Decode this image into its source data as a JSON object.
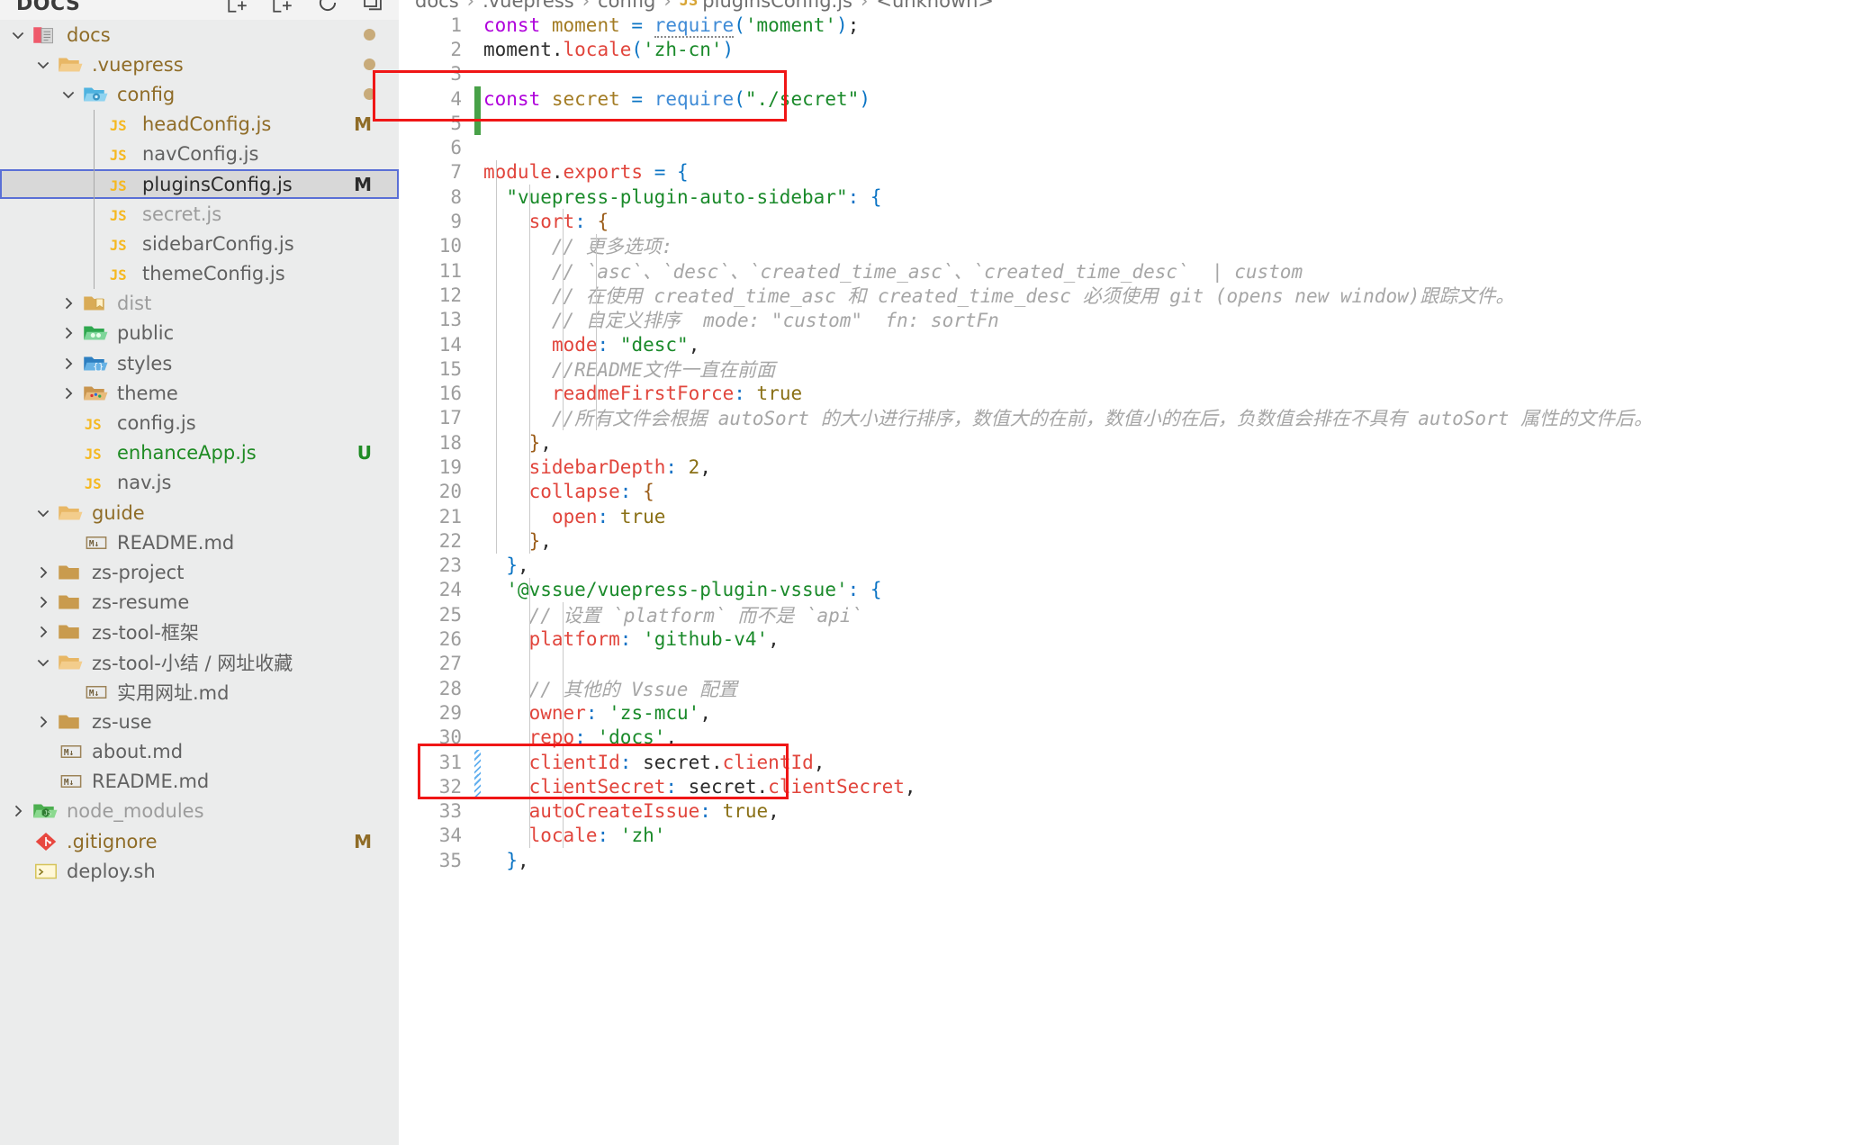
{
  "explorer": {
    "title": "DOCS",
    "actions": [
      "new-file-icon",
      "new-folder-icon",
      "refresh-icon",
      "collapse-all-icon"
    ]
  },
  "tree": [
    {
      "indent": 0,
      "twisty": "down",
      "icon": "folder-docs",
      "label": "docs",
      "labelColor": "mod",
      "badge": "",
      "dot": true
    },
    {
      "indent": 1,
      "twisty": "down",
      "icon": "folder-open",
      "label": ".vuepress",
      "labelColor": "mod",
      "badge": "",
      "dot": true
    },
    {
      "indent": 2,
      "twisty": "down",
      "icon": "folder-config",
      "label": "config",
      "labelColor": "mod",
      "badge": "",
      "dot": true
    },
    {
      "indent": 3,
      "twisty": "none",
      "icon": "js",
      "label": "headConfig.js",
      "labelColor": "mod",
      "badge": "M",
      "badgeColor": "mod",
      "dot": false
    },
    {
      "indent": 3,
      "twisty": "none",
      "icon": "js",
      "label": "navConfig.js",
      "labelColor": "norm",
      "badge": "",
      "dot": false
    },
    {
      "indent": 3,
      "twisty": "none",
      "icon": "js",
      "label": "pluginsConfig.js",
      "labelColor": "sel",
      "badge": "M",
      "badgeColor": "sel",
      "dot": false,
      "selected": true
    },
    {
      "indent": 3,
      "twisty": "none",
      "icon": "js",
      "label": "secret.js",
      "labelColor": "dim",
      "badge": "",
      "dot": false
    },
    {
      "indent": 3,
      "twisty": "none",
      "icon": "js",
      "label": "sidebarConfig.js",
      "labelColor": "norm",
      "badge": "",
      "dot": false
    },
    {
      "indent": 3,
      "twisty": "none",
      "icon": "js",
      "label": "themeConfig.js",
      "labelColor": "norm",
      "badge": "",
      "dot": false
    },
    {
      "indent": 2,
      "twisty": "right",
      "icon": "folder-dist",
      "label": "dist",
      "labelColor": "dim",
      "badge": "",
      "dot": false
    },
    {
      "indent": 2,
      "twisty": "right",
      "icon": "folder-public",
      "label": "public",
      "labelColor": "norm",
      "badge": "",
      "dot": false
    },
    {
      "indent": 2,
      "twisty": "right",
      "icon": "folder-styles",
      "label": "styles",
      "labelColor": "norm",
      "badge": "",
      "dot": false
    },
    {
      "indent": 2,
      "twisty": "right",
      "icon": "folder-theme",
      "label": "theme",
      "labelColor": "norm",
      "badge": "",
      "dot": false
    },
    {
      "indent": 2,
      "twisty": "none",
      "icon": "js",
      "label": "config.js",
      "labelColor": "norm",
      "badge": "",
      "dot": false
    },
    {
      "indent": 2,
      "twisty": "none",
      "icon": "js",
      "label": "enhanceApp.js",
      "labelColor": "add",
      "badge": "U",
      "badgeColor": "add",
      "dot": false
    },
    {
      "indent": 2,
      "twisty": "none",
      "icon": "js",
      "label": "nav.js",
      "labelColor": "norm",
      "badge": "",
      "dot": false
    },
    {
      "indent": 1,
      "twisty": "down",
      "icon": "folder-open",
      "label": "guide",
      "labelColor": "mod",
      "badge": "",
      "dot": false
    },
    {
      "indent": 2,
      "twisty": "none",
      "icon": "md",
      "label": "README.md",
      "labelColor": "norm",
      "badge": "",
      "dot": false
    },
    {
      "indent": 1,
      "twisty": "right",
      "icon": "folder-closed",
      "label": "zs-project",
      "labelColor": "norm",
      "badge": "",
      "dot": false
    },
    {
      "indent": 1,
      "twisty": "right",
      "icon": "folder-closed",
      "label": "zs-resume",
      "labelColor": "norm",
      "badge": "",
      "dot": false
    },
    {
      "indent": 1,
      "twisty": "right",
      "icon": "folder-closed",
      "label": "zs-tool-框架",
      "labelColor": "norm",
      "badge": "",
      "dot": false
    },
    {
      "indent": 1,
      "twisty": "down",
      "icon": "folder-open",
      "label": "zs-tool-小结 / 网址收藏",
      "labelColor": "norm",
      "badge": "",
      "dot": false
    },
    {
      "indent": 2,
      "twisty": "none",
      "icon": "md",
      "label": "实用网址.md",
      "labelColor": "norm",
      "badge": "",
      "dot": false
    },
    {
      "indent": 1,
      "twisty": "right",
      "icon": "folder-closed",
      "label": "zs-use",
      "labelColor": "norm",
      "badge": "",
      "dot": false
    },
    {
      "indent": 1,
      "twisty": "none",
      "icon": "md",
      "label": "about.md",
      "labelColor": "norm",
      "badge": "",
      "dot": false
    },
    {
      "indent": 1,
      "twisty": "none",
      "icon": "md",
      "label": "README.md",
      "labelColor": "norm",
      "badge": "",
      "dot": false
    },
    {
      "indent": 0,
      "twisty": "right",
      "icon": "folder-node",
      "label": "node_modules",
      "labelColor": "dim",
      "badge": "",
      "dot": false
    },
    {
      "indent": 0,
      "twisty": "none",
      "icon": "git",
      "label": ".gitignore",
      "labelColor": "mod",
      "badge": "M",
      "badgeColor": "mod",
      "dot": false
    },
    {
      "indent": 0,
      "twisty": "none",
      "icon": "sh",
      "label": "deploy.sh",
      "labelColor": "norm",
      "badge": "",
      "dot": false
    }
  ],
  "breadcrumb": {
    "parts": [
      "docs",
      ".vuepress",
      "config"
    ],
    "file": "pluginsConfig.js",
    "symbol": "<unknown>"
  },
  "code": {
    "language": "javascript",
    "first_line": 1,
    "lines": [
      {
        "n": 1,
        "gutter": "none",
        "text": "const moment = require('moment');"
      },
      {
        "n": 2,
        "gutter": "none",
        "text": "moment.locale('zh-cn')"
      },
      {
        "n": 3,
        "gutter": "none",
        "text": ""
      },
      {
        "n": 4,
        "gutter": "add",
        "text": "const secret = require(\"./secret\")"
      },
      {
        "n": 5,
        "gutter": "add",
        "text": ""
      },
      {
        "n": 6,
        "gutter": "none",
        "text": ""
      },
      {
        "n": 7,
        "gutter": "none",
        "text": "module.exports = {"
      },
      {
        "n": 8,
        "gutter": "none",
        "text": "  \"vuepress-plugin-auto-sidebar\": {"
      },
      {
        "n": 9,
        "gutter": "none",
        "text": "    sort: {"
      },
      {
        "n": 10,
        "gutter": "none",
        "text": "      // 更多选项:"
      },
      {
        "n": 11,
        "gutter": "none",
        "text": "      // `asc`、`desc`、`created_time_asc`、`created_time_desc`  | custom"
      },
      {
        "n": 12,
        "gutter": "none",
        "text": "      // 在使用 created_time_asc 和 created_time_desc 必须使用 git (opens new window)跟踪文件。"
      },
      {
        "n": 13,
        "gutter": "none",
        "text": "      // 自定义排序  mode: \"custom\"  fn: sortFn"
      },
      {
        "n": 14,
        "gutter": "none",
        "text": "      mode: \"desc\","
      },
      {
        "n": 15,
        "gutter": "none",
        "text": "      //README文件一直在前面"
      },
      {
        "n": 16,
        "gutter": "none",
        "text": "      readmeFirstForce: true"
      },
      {
        "n": 17,
        "gutter": "none",
        "text": "      //所有文件会根据 autoSort 的大小进行排序，数值大的在前，数值小的在后，负数值会排在不具有 autoSort 属性的文件后。"
      },
      {
        "n": 18,
        "gutter": "none",
        "text": "    },"
      },
      {
        "n": 19,
        "gutter": "none",
        "text": "    sidebarDepth: 2,"
      },
      {
        "n": 20,
        "gutter": "none",
        "text": "    collapse: {"
      },
      {
        "n": 21,
        "gutter": "none",
        "text": "      open: true"
      },
      {
        "n": 22,
        "gutter": "none",
        "text": "    },"
      },
      {
        "n": 23,
        "gutter": "none",
        "text": "  },"
      },
      {
        "n": 24,
        "gutter": "none",
        "text": "  '@vssue/vuepress-plugin-vssue': {"
      },
      {
        "n": 25,
        "gutter": "none",
        "text": "    // 设置 `platform` 而不是 `api`"
      },
      {
        "n": 26,
        "gutter": "none",
        "text": "    platform: 'github-v4',"
      },
      {
        "n": 27,
        "gutter": "none",
        "text": ""
      },
      {
        "n": 28,
        "gutter": "none",
        "text": "    // 其他的 Vssue 配置"
      },
      {
        "n": 29,
        "gutter": "none",
        "text": "    owner: 'zs-mcu',"
      },
      {
        "n": 30,
        "gutter": "none",
        "text": "    repo: 'docs',"
      },
      {
        "n": 31,
        "gutter": "chg",
        "text": "    clientId: secret.clientId,"
      },
      {
        "n": 32,
        "gutter": "chg",
        "text": "    clientSecret: secret.clientSecret,"
      },
      {
        "n": 33,
        "gutter": "none",
        "text": "    autoCreateIssue: true,"
      },
      {
        "n": 34,
        "gutter": "none",
        "text": "    locale: 'zh'"
      },
      {
        "n": 35,
        "gutter": "none",
        "text": "  },"
      }
    ]
  },
  "annotations": [
    {
      "name": "highlight-box-require-secret",
      "label": "",
      "covers_lines": [
        3,
        4
      ],
      "color": "#f01616"
    },
    {
      "name": "highlight-box-client-credentials",
      "label": "",
      "covers_lines": [
        31,
        32
      ],
      "color": "#f01616"
    }
  ],
  "colors": {
    "sidebar_bg": "#ebecec",
    "selection_bg": "#d8d8d8",
    "selection_border": "#5a6fd6",
    "annotation_red": "#f01616",
    "gutter_add_green": "#48a148",
    "gutter_change_blue": "#63b0ef",
    "modified_gold": "#8f6c27",
    "untracked_green": "#1f8b24"
  }
}
